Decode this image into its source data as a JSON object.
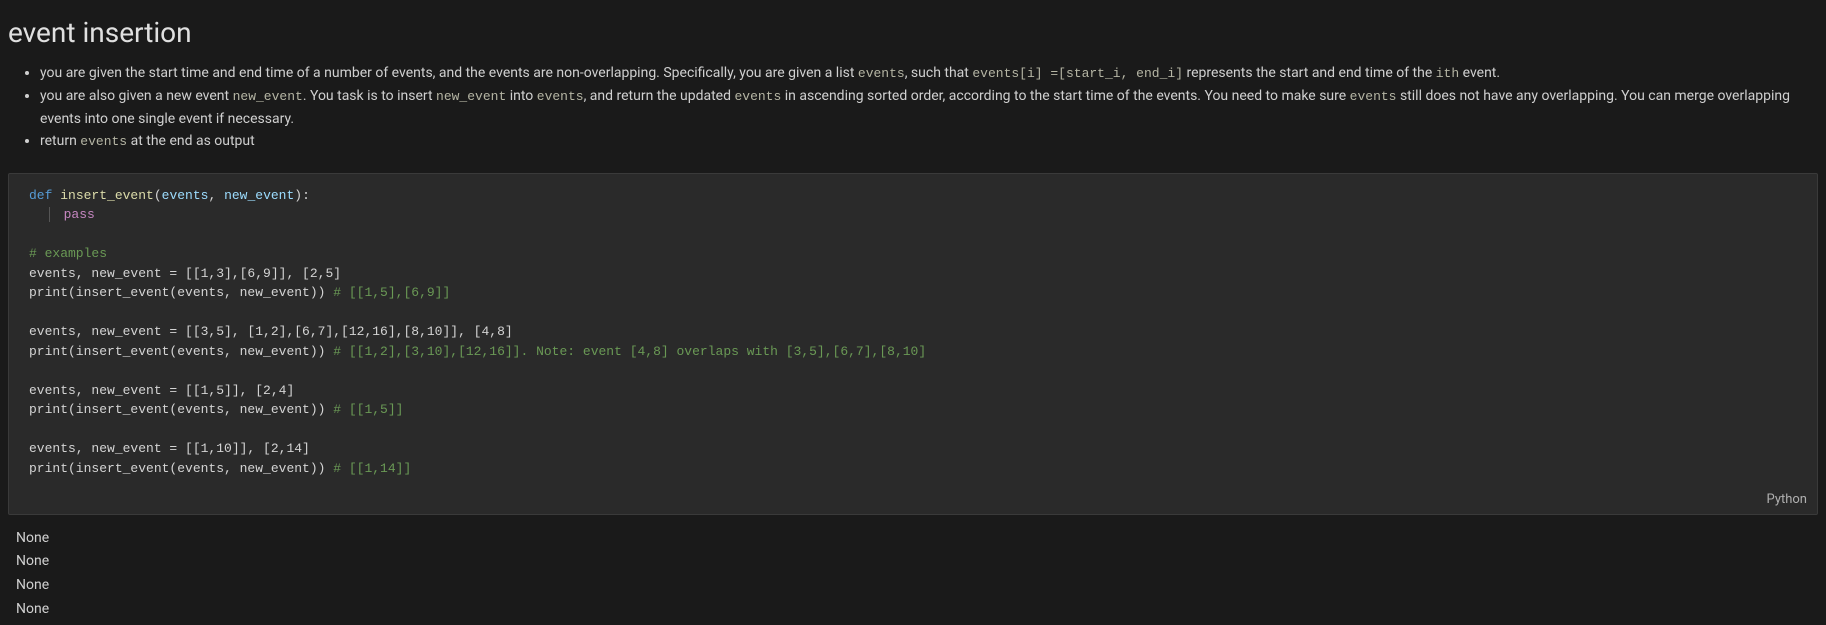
{
  "title": "event insertion",
  "bullets": [
    {
      "parts": [
        {
          "type": "text",
          "value": "you are given the start time and end time of a number of events, and the events are non-overlapping. Specifically, you are given a list "
        },
        {
          "type": "code",
          "value": "events"
        },
        {
          "type": "text",
          "value": ", such that "
        },
        {
          "type": "code",
          "value": "events[i] =[start_i, end_i]"
        },
        {
          "type": "text",
          "value": " represents the start and end time of the "
        },
        {
          "type": "code",
          "value": "ith"
        },
        {
          "type": "text",
          "value": " event."
        }
      ]
    },
    {
      "parts": [
        {
          "type": "text",
          "value": "you are also given a new event "
        },
        {
          "type": "code",
          "value": "new_event"
        },
        {
          "type": "text",
          "value": ". You task is to insert "
        },
        {
          "type": "code",
          "value": "new_event"
        },
        {
          "type": "text",
          "value": " into "
        },
        {
          "type": "code",
          "value": "events"
        },
        {
          "type": "text",
          "value": ", and return the updated "
        },
        {
          "type": "code",
          "value": "events"
        },
        {
          "type": "text",
          "value": " in ascending sorted order, according to the start time of the events. You need to make sure "
        },
        {
          "type": "code",
          "value": "events"
        },
        {
          "type": "text",
          "value": " still does not have any overlapping. You can merge overlapping events into one single event if necessary."
        }
      ]
    },
    {
      "parts": [
        {
          "type": "text",
          "value": "return "
        },
        {
          "type": "code",
          "value": "events"
        },
        {
          "type": "text",
          "value": " at the end as output"
        }
      ]
    }
  ],
  "code": {
    "language": "Python",
    "tokens": [
      [
        {
          "cls": "kw-def",
          "t": "def "
        },
        {
          "cls": "fn-name",
          "t": "insert_event"
        },
        {
          "cls": "punct",
          "t": "("
        },
        {
          "cls": "param",
          "t": "events"
        },
        {
          "cls": "punct",
          "t": ", "
        },
        {
          "cls": "param",
          "t": "new_event"
        },
        {
          "cls": "punct",
          "t": "):"
        }
      ],
      [
        {
          "cls": "indent",
          "t": "    "
        },
        {
          "cls": "kw-pass",
          "t": "pass"
        }
      ],
      [],
      [
        {
          "cls": "comment",
          "t": "# examples"
        }
      ],
      [
        {
          "cls": "punct",
          "t": "events, new_event = [[1,3],[6,9]], [2,5]"
        }
      ],
      [
        {
          "cls": "punct",
          "t": "print(insert_event(events, new_event)) "
        },
        {
          "cls": "comment",
          "t": "# [[1,5],[6,9]]"
        }
      ],
      [],
      [
        {
          "cls": "punct",
          "t": "events, new_event = [[3,5], [1,2],[6,7],[12,16],[8,10]], [4,8]"
        }
      ],
      [
        {
          "cls": "punct",
          "t": "print(insert_event(events, new_event)) "
        },
        {
          "cls": "comment",
          "t": "# [[1,2],[3,10],[12,16]]. Note: event [4,8] overlaps with [3,5],[6,7],[8,10]"
        }
      ],
      [],
      [
        {
          "cls": "punct",
          "t": "events, new_event = [[1,5]], [2,4]"
        }
      ],
      [
        {
          "cls": "punct",
          "t": "print(insert_event(events, new_event)) "
        },
        {
          "cls": "comment",
          "t": "# [[1,5]]"
        }
      ],
      [],
      [
        {
          "cls": "punct",
          "t": "events, new_event = [[1,10]], [2,14]"
        }
      ],
      [
        {
          "cls": "punct",
          "t": "print(insert_event(events, new_event)) "
        },
        {
          "cls": "comment",
          "t": "# [[1,14]]"
        }
      ]
    ]
  },
  "output_lines": [
    "None",
    "None",
    "None",
    "None"
  ]
}
